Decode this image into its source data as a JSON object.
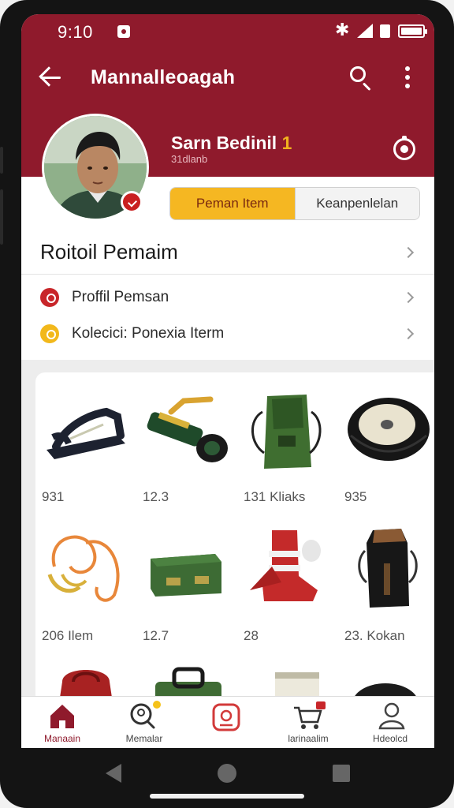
{
  "status_bar": {
    "time": "9:10",
    "bluetooth_icon": "bluetooth-icon",
    "signal_icon": "signal-icon",
    "battery_icon": "battery-icon"
  },
  "app_bar": {
    "title": "Mannalleoagah",
    "back_icon": "arrow-left-icon",
    "search_icon": "search-icon",
    "more_icon": "more-vert-icon"
  },
  "profile": {
    "name": "Sarn Bedinil",
    "name_accent": "1",
    "subtitle": "31dlanb",
    "settings_icon": "settings-icon"
  },
  "tabs": [
    {
      "label": "Peman Item",
      "active": true
    },
    {
      "label": "Keanpenlelan",
      "active": false
    }
  ],
  "section": {
    "title": "Roitoil Pemaim"
  },
  "menu": [
    {
      "label": "Proffil Pemsan",
      "icon": "profile-icon",
      "color": "#c8262a"
    },
    {
      "label": "Kolecici: Ponexia Iterm",
      "icon": "collection-icon",
      "color": "#f2b81b"
    }
  ],
  "items": [
    {
      "caption": "931",
      "icon": "sandal-icon"
    },
    {
      "caption": "12.3",
      "icon": "tool-icon"
    },
    {
      "caption": "131 Kliaks",
      "icon": "bag-icon"
    },
    {
      "caption": "935",
      "icon": "tire-icon"
    },
    {
      "caption": "206 Ilem",
      "icon": "rope-icon"
    },
    {
      "caption": "12.7",
      "icon": "case-icon"
    },
    {
      "caption": "28",
      "icon": "boot-icon"
    },
    {
      "caption": "23. Kokan",
      "icon": "holster-icon"
    },
    {
      "caption": "",
      "icon": "red-bag-icon"
    },
    {
      "caption": "",
      "icon": "green-box-icon"
    },
    {
      "caption": "",
      "icon": "white-pack-icon"
    },
    {
      "caption": "",
      "icon": "dark-round-icon"
    }
  ],
  "bottom_nav": [
    {
      "label": "Manaain",
      "icon": "home-icon",
      "active": true
    },
    {
      "label": "Memalar",
      "icon": "search-nav-icon",
      "active": false
    },
    {
      "label": "",
      "icon": "scan-icon",
      "active": false
    },
    {
      "label": "larinaalim",
      "icon": "cart-icon",
      "active": false
    },
    {
      "label": "Hdeolcd",
      "icon": "person-icon",
      "active": false
    }
  ],
  "colors": {
    "primary": "#8f1a2c",
    "accent": "#f5b722",
    "background": "#ffffff"
  }
}
